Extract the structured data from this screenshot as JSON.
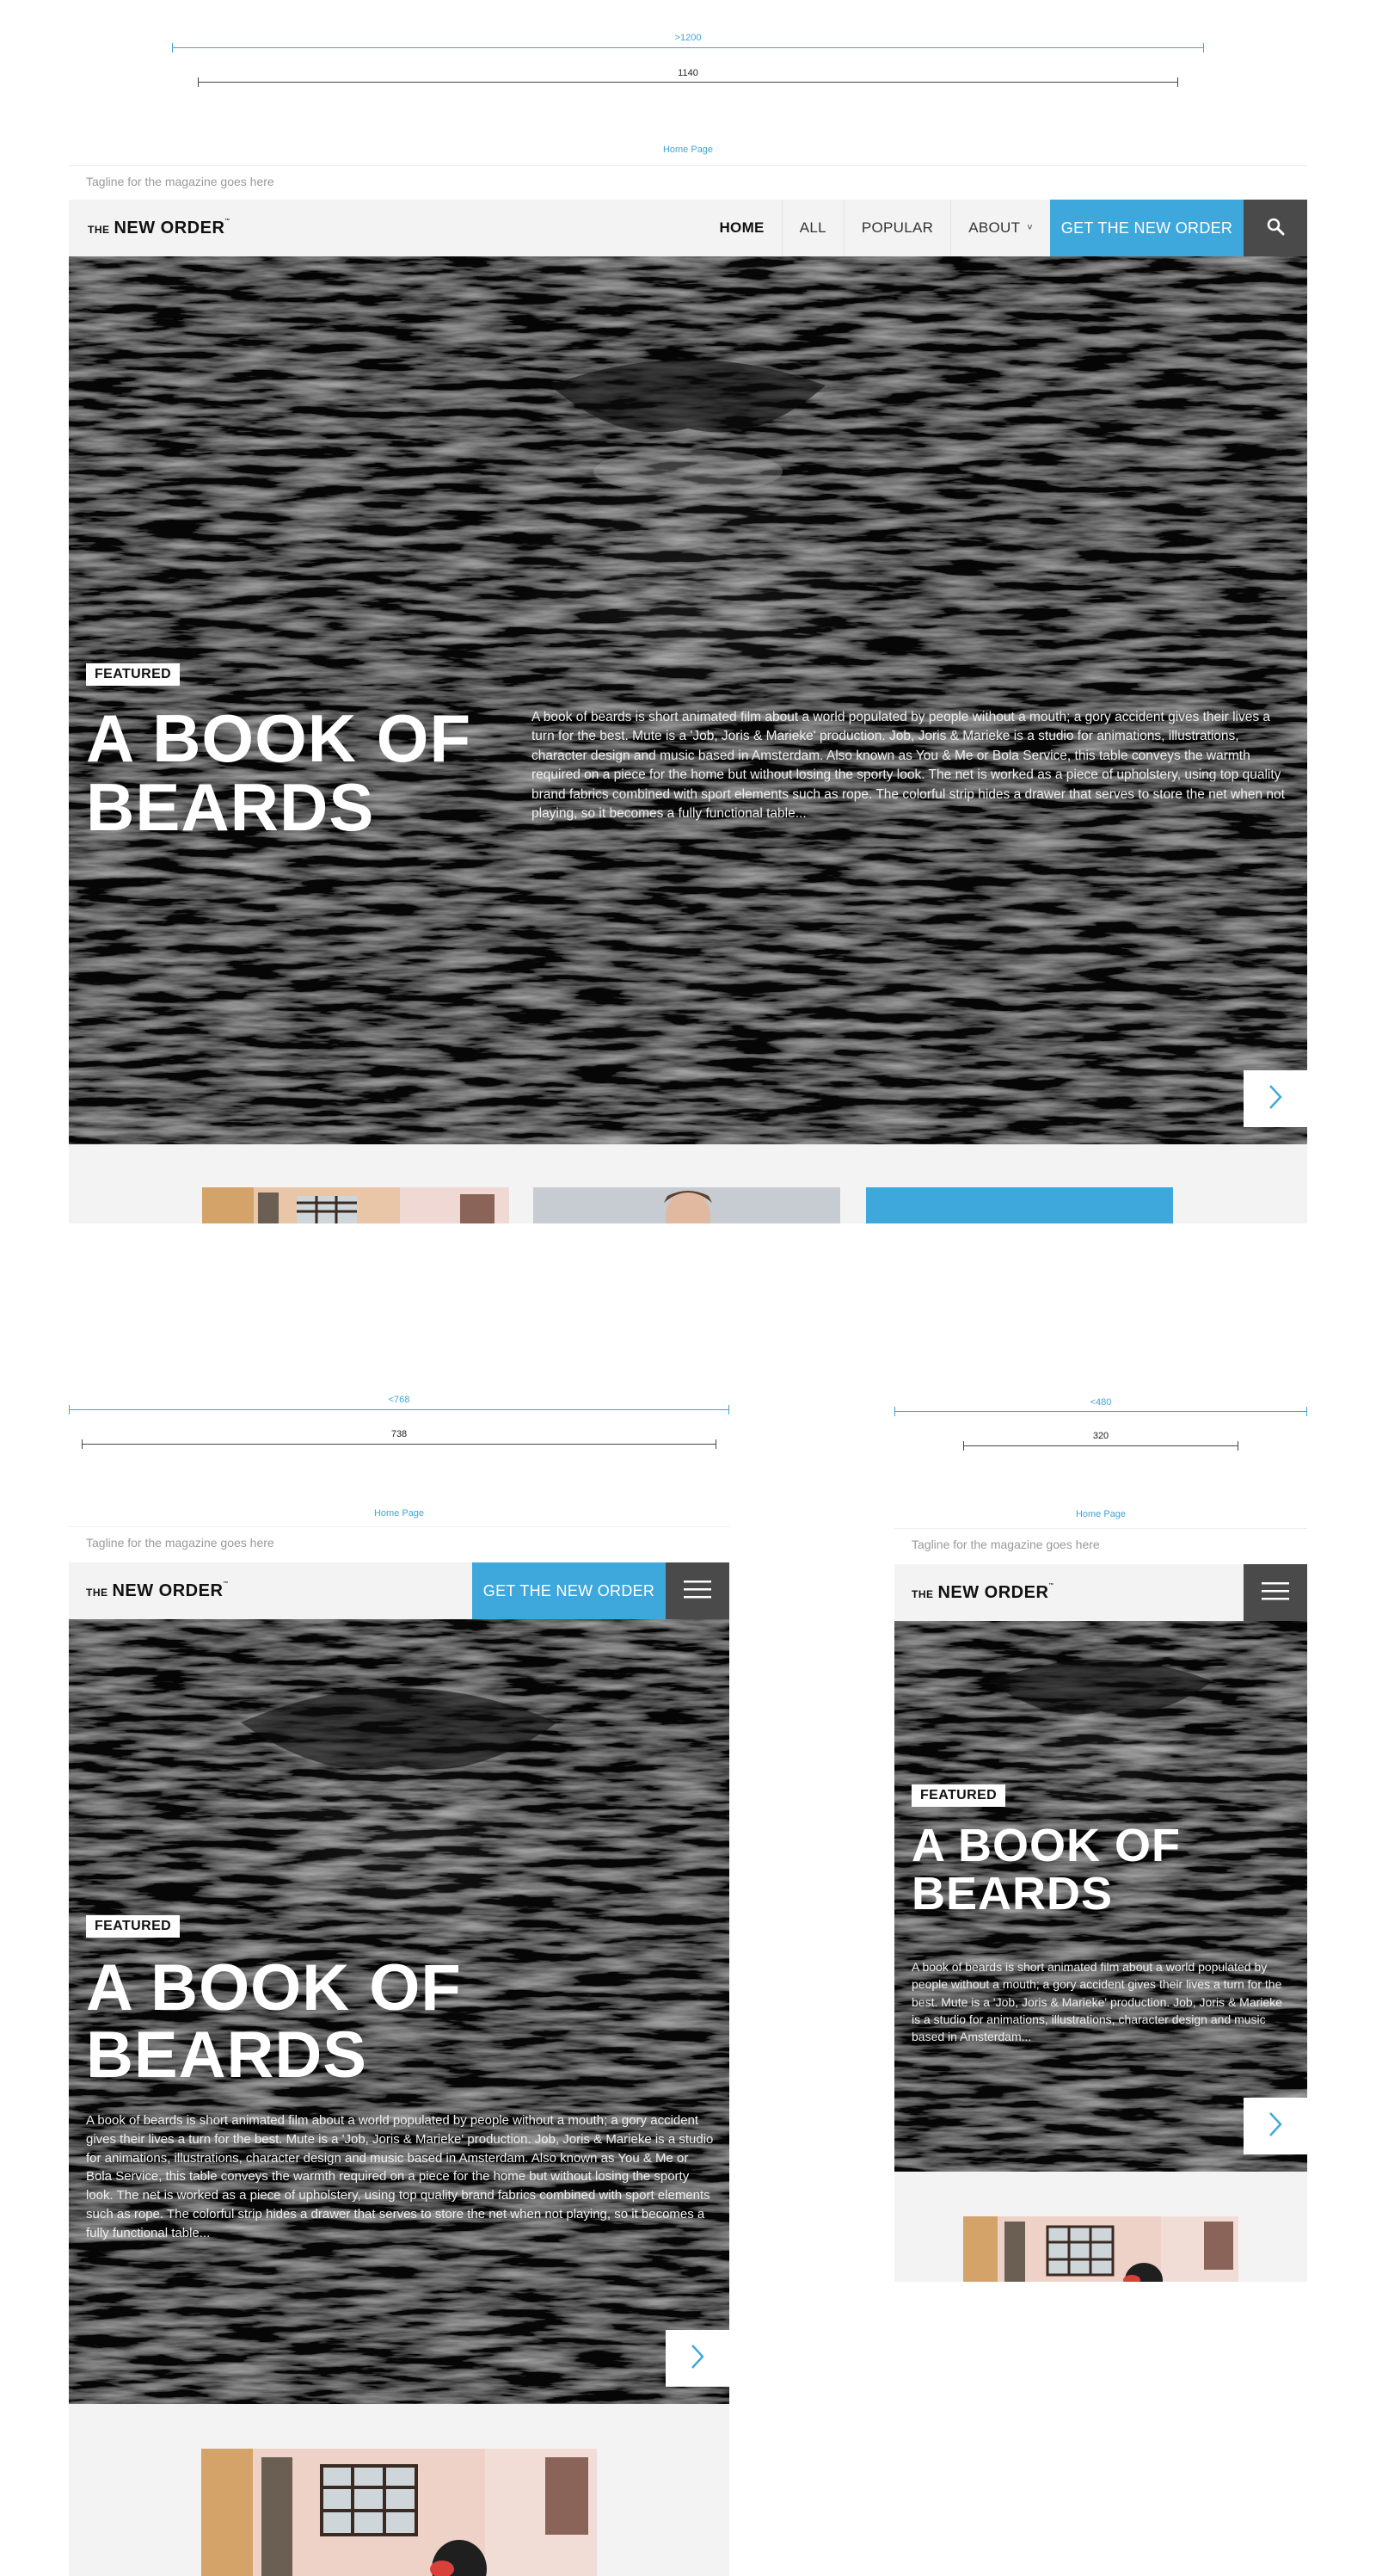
{
  "desktop": {
    "dim_outer": ">1200",
    "dim_inner": "1140",
    "page_label": "Home Page",
    "tagline": "Tagline for the magazine goes here",
    "brand": {
      "the": "THE",
      "name": "NEW ORDER",
      "tm": "™"
    },
    "nav": [
      {
        "label": "HOME",
        "active": true
      },
      {
        "label": "ALL"
      },
      {
        "label": "POPULAR"
      },
      {
        "label": "ABOUT",
        "dropdown": true
      }
    ],
    "dropdown_glyph": "˅",
    "cta": "GET THE NEW ORDER",
    "featured": "FEATURED",
    "title_line1": "A BOOK OF",
    "title_line2": "BEARDS",
    "description": "A book of beards is short animated film about a world populated by people without a mouth; a gory accident gives their lives a turn for the best. Mute is a 'Job, Joris & Marieke' production. Job, Joris & Marieke is a studio for animations, illustrations, character design and music based in Amsterdam. Also known as You & Me or Bola Service, this table conveys the warmth required on a piece for the home but without losing the sporty look. The net is worked as a piece of upholstery, using top quality brand fabrics combined with sport elements such as rope. The colorful strip hides a drawer that serves to store the net when not playing, so it becomes a fully functional table..."
  },
  "tablet": {
    "dim_outer": "<768",
    "dim_inner": "738",
    "page_label": "Home Page",
    "tagline": "Tagline for the magazine goes here",
    "cta": "GET THE NEW ORDER",
    "featured": "FEATURED",
    "title_line1": "A BOOK OF",
    "title_line2": "BEARDS",
    "description": "A book of beards is short animated film about a world populated by people without a mouth; a gory accident gives their lives a turn for the best. Mute is a 'Job, Joris & Marieke' production. Job, Joris & Marieke is a studio for animations, illustrations, character design and music based in Amsterdam. Also known as You & Me or Bola Service, this table conveys the warmth required on a piece for the home but without losing the sporty look. The net is worked as a piece of upholstery, using top quality brand fabrics combined with sport elements such as rope. The colorful strip hides a drawer that serves to store the net when not playing, so it becomes a fully functional table..."
  },
  "mobile": {
    "dim_outer": "<480",
    "dim_inner": "320",
    "page_label": "Home Page",
    "tagline": "Tagline for the magazine goes here",
    "featured": "FEATURED",
    "title_line1": "A BOOK OF",
    "title_line2": "BEARDS",
    "description": "A book of beards is short animated film about a world populated by people without a mouth; a gory accident gives their lives a turn for the best. Mute is a 'Job, Joris & Marieke' production. Job, Joris & Marieke is a studio for animations, illustrations, character design and music based in Amsterdam..."
  },
  "icons": {
    "search": "search-icon",
    "menu": "hamburger-menu-icon",
    "next": "chevron-right-icon"
  },
  "colors": {
    "accent": "#3ea8dc",
    "nav_bg": "#f3f3f3",
    "dark_button": "#4a4a4a",
    "guide_blue": "#3ea6d6"
  }
}
